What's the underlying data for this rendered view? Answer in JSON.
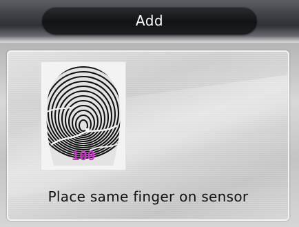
{
  "header": {
    "title": "Add"
  },
  "enroll": {
    "fingerprint_icon": "fingerprint-image",
    "quality_value": "100",
    "quality_color": "#cc33cc",
    "prompt": "Place same finger on sensor"
  },
  "colors": {
    "title_text": "#ffffff",
    "title_pill": "#151618",
    "prompt_text": "#111111"
  }
}
